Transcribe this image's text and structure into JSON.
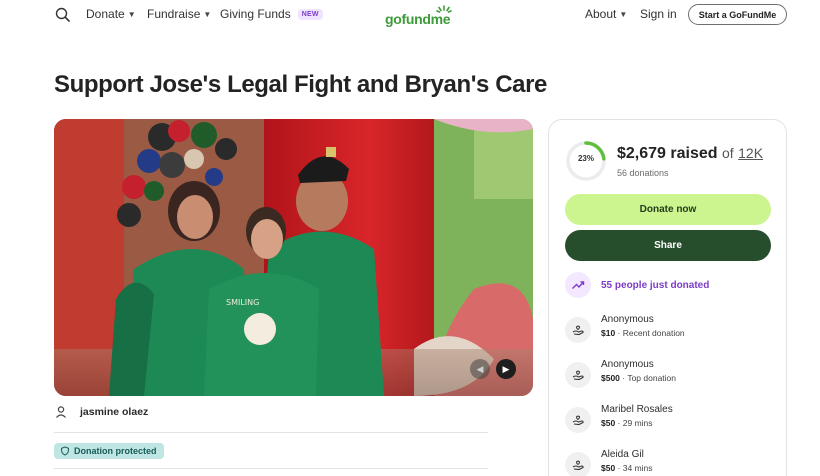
{
  "header": {
    "nav_left": [
      {
        "label": "Donate",
        "has_caret": true
      },
      {
        "label": "Fundraise",
        "has_caret": true
      },
      {
        "label": "Giving Funds",
        "badge": "NEW"
      }
    ],
    "logo_text": "gofundme",
    "nav_right": [
      {
        "label": "About",
        "has_caret": true
      },
      {
        "label": "Sign in"
      }
    ],
    "start_button": "Start a GoFundMe"
  },
  "campaign": {
    "title": "Support Jose's Legal Fight and Bryan's Care",
    "organizer_name": "jasmine olaez",
    "protected_label": "Donation protected"
  },
  "donation_card": {
    "progress_percent": 23,
    "progress_text": "23%",
    "raised_amount": "$2,679 raised",
    "of_text": "of",
    "goal": "12K",
    "donation_count": "56 donations",
    "donate_button": "Donate now",
    "share_button": "Share",
    "trend_text": "55 people just donated",
    "donors": [
      {
        "name": "Anonymous",
        "amount": "$10",
        "note": "Recent donation"
      },
      {
        "name": "Anonymous",
        "amount": "$500",
        "note": "Top donation"
      },
      {
        "name": "Maribel Rosales",
        "amount": "$50",
        "note": "29 mins"
      },
      {
        "name": "Aleida Gil",
        "amount": "$50",
        "note": "34 mins"
      }
    ]
  },
  "colors": {
    "brand_green": "#3d9b3a",
    "donate_button": "#cdf58f",
    "share_button": "#274e2c",
    "trend_purple": "#7d3cc8",
    "badge_purple_bg": "#efe3ff",
    "protected_bg": "#bfe6e3"
  }
}
